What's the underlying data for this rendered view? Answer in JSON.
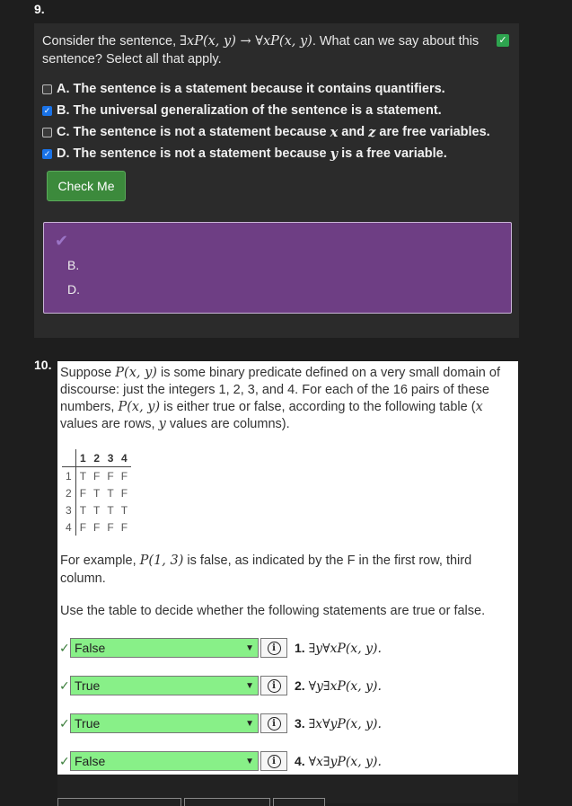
{
  "q9": {
    "number": "9.",
    "prompt_pre": "Consider the sentence,",
    "prompt_formula": "∃xP(x, y) → ∀xP(x, y)",
    "prompt_post": ". What can we say about this sentence? Select all that apply.",
    "status_icon": "check-icon",
    "options": [
      {
        "label": "A. The sentence is a statement because it contains quantifiers.",
        "checked": false
      },
      {
        "label": "B. The universal generalization of the sentence is a statement.",
        "checked": true
      },
      {
        "label_pre": "C. The sentence is not a statement because ",
        "var1": "x",
        "label_mid": " and ",
        "var2": "z",
        "label_post": " are free variables.",
        "checked": false
      },
      {
        "label_pre": "D. The sentence is not a statement because ",
        "var1": "y",
        "label_post": " is a free variable.",
        "checked": true
      }
    ],
    "check_button": "Check Me",
    "feedback": {
      "items": [
        "B.",
        "D."
      ],
      "color": "#6e3e84"
    }
  },
  "q10": {
    "number": "10.",
    "prompt": {
      "p1": "Suppose ",
      "m1": "P(x, y)",
      "p2": " is some binary predicate defined on a very small domain of discourse: just the integers 1, 2, 3, and 4. For each of the 16 pairs of these numbers, ",
      "m2": "P(x, y)",
      "p3": " is either true or false, according to the following table (",
      "m3": "x",
      "p4": " values are rows, ",
      "m4": "y",
      "p5": " values are columns)."
    },
    "table": {
      "cols": [
        "1",
        "2",
        "3",
        "4"
      ],
      "rows": [
        {
          "h": "1",
          "v": [
            "T",
            "F",
            "F",
            "F"
          ]
        },
        {
          "h": "2",
          "v": [
            "F",
            "T",
            "T",
            "F"
          ]
        },
        {
          "h": "3",
          "v": [
            "T",
            "T",
            "T",
            "T"
          ]
        },
        {
          "h": "4",
          "v": [
            "F",
            "F",
            "F",
            "F"
          ]
        }
      ]
    },
    "example": {
      "p1": "For example, ",
      "m1": "P(1, 3)",
      "p2": " is false, as indicated by the F in the first row, third column."
    },
    "instruction": "Use the table to decide whether the following statements are true or false.",
    "statements": [
      {
        "answer": "False",
        "num": "1.",
        "formula": "∃y∀xP(x, y)."
      },
      {
        "answer": "True",
        "num": "2.",
        "formula": "∀y∃xP(x, y)."
      },
      {
        "answer": "True",
        "num": "3.",
        "formula": "∃x∀yP(x, y)."
      },
      {
        "answer": "False",
        "num": "4.",
        "formula": "∀x∃yP(x, y)."
      }
    ],
    "select_color": "#88f088"
  }
}
